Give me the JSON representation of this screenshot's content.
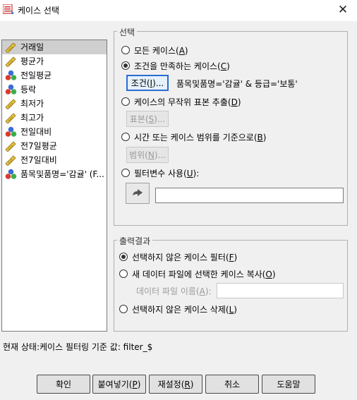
{
  "window": {
    "title": "케이스 선택",
    "close_glyph": "✕"
  },
  "variables": [
    {
      "name": "거래일",
      "icon": "ruler-icon"
    },
    {
      "name": "평균가",
      "icon": "ruler-icon"
    },
    {
      "name": "전일평균",
      "icon": "nominal-balls-icon"
    },
    {
      "name": "등락",
      "icon": "nominal-balls-icon"
    },
    {
      "name": "최저가",
      "icon": "ruler-icon"
    },
    {
      "name": "최고가",
      "icon": "ruler-icon"
    },
    {
      "name": "전일대비",
      "icon": "nominal-balls-icon"
    },
    {
      "name": "전7일평균",
      "icon": "ruler-icon"
    },
    {
      "name": "전7일대비",
      "icon": "ruler-icon"
    },
    {
      "name": "품목및품명='감귤' (F...",
      "icon": "nominal-balls-icon"
    }
  ],
  "selection": {
    "title": "선택",
    "all_cases": {
      "text": "모든 케이스(",
      "key": "A",
      "end": ")",
      "checked": false
    },
    "if_condition": {
      "text": "조건을 만족하는 케이스(",
      "key": "C",
      "end": ")",
      "checked": true
    },
    "if_button": {
      "text": "조건(",
      "key": "I",
      "end": ")..."
    },
    "condition_text": "품목및품명='감귤' & 등급='보통'",
    "random_sample": {
      "text": "케이스의 무작위 표본 추출(",
      "key": "D",
      "end": ")",
      "checked": false
    },
    "sample_button": {
      "text": "표본(",
      "key": "S",
      "end": ")..."
    },
    "range": {
      "text": "시간 또는 케이스 범위를 기준으로(",
      "key": "B",
      "end": ")",
      "checked": false
    },
    "range_button": {
      "text": "범위(",
      "key": "N",
      "end": ")..."
    },
    "filter_var": {
      "text": "필터변수 사용(",
      "key": "U",
      "end": "):",
      "checked": false
    },
    "filter_value": ""
  },
  "output": {
    "title": "출력결과",
    "filter": {
      "text": "선택하지 않은 케이스 필터(",
      "key": "F",
      "end": ")",
      "checked": true
    },
    "copy": {
      "text": "새 데이터 파일에 선택한 케이스 복사(",
      "key": "O",
      "end": ")",
      "checked": false
    },
    "dataset_label": {
      "text": "데이터 파일 이름(",
      "key": "A",
      "end": "):"
    },
    "dataset_value": "",
    "delete": {
      "text": "선택하지 않은 케이스 삭제(",
      "key": "L",
      "end": ")",
      "checked": false
    }
  },
  "status": "현재 상태:케이스 필터링 기준 값: filter_$",
  "buttons": {
    "ok": {
      "text": "확인",
      "key": "",
      "end": ""
    },
    "paste": {
      "text": "붙여넣기(",
      "key": "P",
      "end": ")"
    },
    "reset": {
      "text": "재설정(",
      "key": "R",
      "end": ")"
    },
    "cancel": {
      "text": "취소",
      "key": "",
      "end": ""
    },
    "help": {
      "text": "도움말",
      "key": "",
      "end": ""
    }
  }
}
